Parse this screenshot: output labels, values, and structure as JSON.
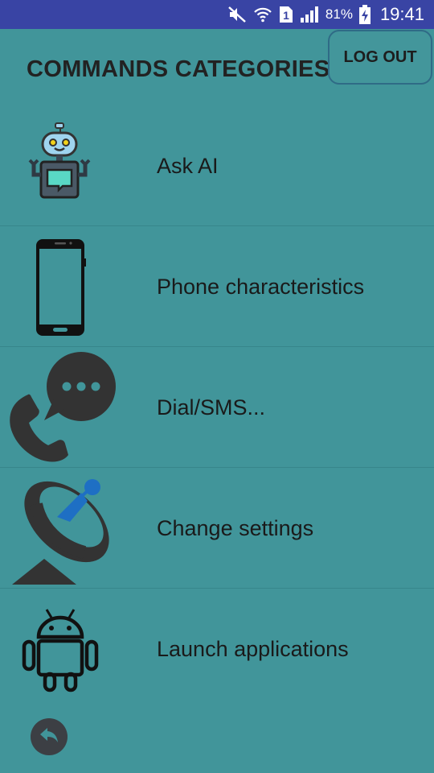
{
  "status_bar": {
    "battery_percent": "81%",
    "time": "19:41",
    "sim_slot": "1",
    "icons": [
      "mute-icon",
      "wifi-icon",
      "sim-icon",
      "signal-icon",
      "battery-charging-icon"
    ]
  },
  "header": {
    "title": "COMMANDS CATEGORIES:",
    "logout_label": "LOG OUT"
  },
  "categories": [
    {
      "label": "Ask AI",
      "icon": "robot-icon"
    },
    {
      "label": "Phone characteristics",
      "icon": "smartphone-icon"
    },
    {
      "label": "Dial/SMS...",
      "icon": "phone-chat-icon"
    },
    {
      "label": "Change settings",
      "icon": "satellite-dish-icon"
    },
    {
      "label": "Launch applications",
      "icon": "android-icon"
    }
  ],
  "footer": {
    "back_icon": "back-arrow-icon"
  },
  "colors": {
    "background": "#41959a",
    "status_bar": "#3944a4",
    "button_border": "#2f6b86",
    "text": "#1a1a1a"
  }
}
